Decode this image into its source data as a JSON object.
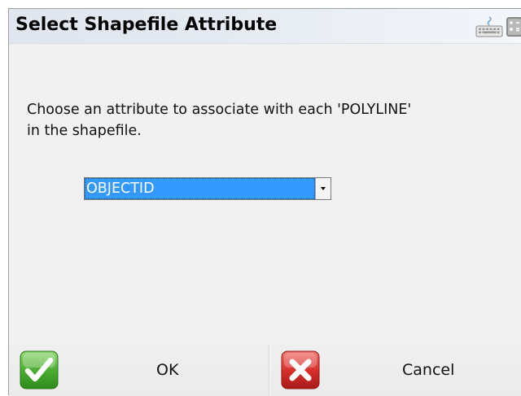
{
  "window": {
    "title": "Select Shapefile Attribute"
  },
  "toolbar_icons": {
    "keyboard": "keyboard-icon",
    "calculator": "calculator-icon"
  },
  "prompt": {
    "line1": "Choose an attribute to associate with each 'POLYLINE'",
    "line2": "in the shapefile."
  },
  "attribute_select": {
    "selected": "OBJECTID"
  },
  "buttons": {
    "ok": {
      "label": "OK",
      "icon": "checkmark-icon",
      "color": "#3fa02a"
    },
    "cancel": {
      "label": "Cancel",
      "icon": "x-icon",
      "color": "#d3242a"
    }
  },
  "colors": {
    "selection": "#3399ff",
    "background": "#f1f1f1"
  }
}
